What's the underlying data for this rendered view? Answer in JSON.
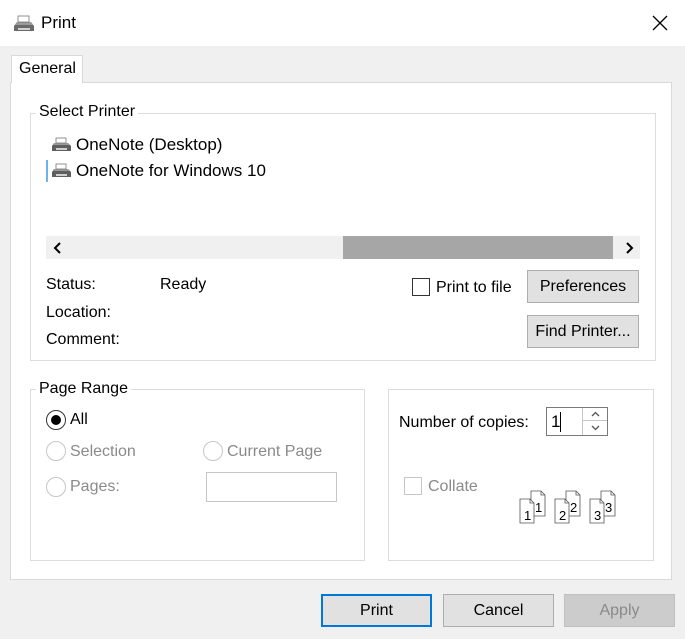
{
  "window": {
    "title": "Print",
    "icon": "printer-icon",
    "close_icon": "close-icon"
  },
  "tabs": [
    {
      "label": "General",
      "selected": true
    }
  ],
  "select_printer": {
    "group_label": "Select Printer",
    "printers": [
      {
        "name": "OneNote (Desktop)",
        "icon": "printer-icon"
      },
      {
        "name": "OneNote for Windows 10",
        "icon": "printer-icon",
        "focused": true
      }
    ],
    "status_label": "Status:",
    "status_value": "Ready",
    "location_label": "Location:",
    "comment_label": "Comment:",
    "print_to_file_label": "Print to file",
    "print_to_file_checked": false,
    "preferences_label": "Preferences",
    "find_printer_label": "Find Printer..."
  },
  "page_range": {
    "group_label": "Page Range",
    "all_label": "All",
    "selection_label": "Selection",
    "current_page_label": "Current Page",
    "pages_label": "Pages:",
    "pages_value": "",
    "selected": "All"
  },
  "copies": {
    "number_label": "Number of copies:",
    "number_value": "1",
    "collate_label": "Collate",
    "collate_checked": false,
    "collate_page_labels": [
      "1",
      "1",
      "2",
      "2",
      "3",
      "3"
    ]
  },
  "buttons": {
    "print": "Print",
    "cancel": "Cancel",
    "apply": "Apply"
  },
  "colors": {
    "focus_accent": "#0078d7",
    "dialog_background": "#f0f0f0",
    "panel_background": "#ffffff"
  }
}
